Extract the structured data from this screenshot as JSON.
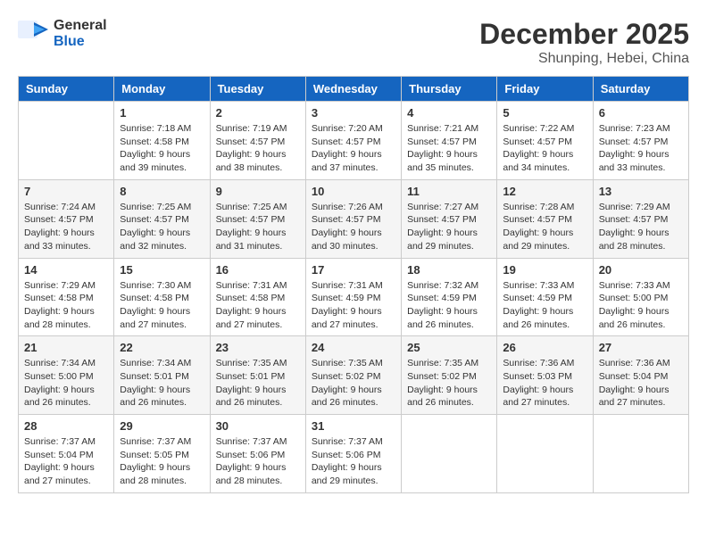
{
  "header": {
    "logo_line1": "General",
    "logo_line2": "Blue",
    "month_year": "December 2025",
    "location": "Shunping, Hebei, China"
  },
  "days_of_week": [
    "Sunday",
    "Monday",
    "Tuesday",
    "Wednesday",
    "Thursday",
    "Friday",
    "Saturday"
  ],
  "weeks": [
    [
      {
        "day": "",
        "info": ""
      },
      {
        "day": "1",
        "info": "Sunrise: 7:18 AM\nSunset: 4:58 PM\nDaylight: 9 hours\nand 39 minutes."
      },
      {
        "day": "2",
        "info": "Sunrise: 7:19 AM\nSunset: 4:57 PM\nDaylight: 9 hours\nand 38 minutes."
      },
      {
        "day": "3",
        "info": "Sunrise: 7:20 AM\nSunset: 4:57 PM\nDaylight: 9 hours\nand 37 minutes."
      },
      {
        "day": "4",
        "info": "Sunrise: 7:21 AM\nSunset: 4:57 PM\nDaylight: 9 hours\nand 35 minutes."
      },
      {
        "day": "5",
        "info": "Sunrise: 7:22 AM\nSunset: 4:57 PM\nDaylight: 9 hours\nand 34 minutes."
      },
      {
        "day": "6",
        "info": "Sunrise: 7:23 AM\nSunset: 4:57 PM\nDaylight: 9 hours\nand 33 minutes."
      }
    ],
    [
      {
        "day": "7",
        "info": "Sunrise: 7:24 AM\nSunset: 4:57 PM\nDaylight: 9 hours\nand 33 minutes."
      },
      {
        "day": "8",
        "info": "Sunrise: 7:25 AM\nSunset: 4:57 PM\nDaylight: 9 hours\nand 32 minutes."
      },
      {
        "day": "9",
        "info": "Sunrise: 7:25 AM\nSunset: 4:57 PM\nDaylight: 9 hours\nand 31 minutes."
      },
      {
        "day": "10",
        "info": "Sunrise: 7:26 AM\nSunset: 4:57 PM\nDaylight: 9 hours\nand 30 minutes."
      },
      {
        "day": "11",
        "info": "Sunrise: 7:27 AM\nSunset: 4:57 PM\nDaylight: 9 hours\nand 29 minutes."
      },
      {
        "day": "12",
        "info": "Sunrise: 7:28 AM\nSunset: 4:57 PM\nDaylight: 9 hours\nand 29 minutes."
      },
      {
        "day": "13",
        "info": "Sunrise: 7:29 AM\nSunset: 4:57 PM\nDaylight: 9 hours\nand 28 minutes."
      }
    ],
    [
      {
        "day": "14",
        "info": "Sunrise: 7:29 AM\nSunset: 4:58 PM\nDaylight: 9 hours\nand 28 minutes."
      },
      {
        "day": "15",
        "info": "Sunrise: 7:30 AM\nSunset: 4:58 PM\nDaylight: 9 hours\nand 27 minutes."
      },
      {
        "day": "16",
        "info": "Sunrise: 7:31 AM\nSunset: 4:58 PM\nDaylight: 9 hours\nand 27 minutes."
      },
      {
        "day": "17",
        "info": "Sunrise: 7:31 AM\nSunset: 4:59 PM\nDaylight: 9 hours\nand 27 minutes."
      },
      {
        "day": "18",
        "info": "Sunrise: 7:32 AM\nSunset: 4:59 PM\nDaylight: 9 hours\nand 26 minutes."
      },
      {
        "day": "19",
        "info": "Sunrise: 7:33 AM\nSunset: 4:59 PM\nDaylight: 9 hours\nand 26 minutes."
      },
      {
        "day": "20",
        "info": "Sunrise: 7:33 AM\nSunset: 5:00 PM\nDaylight: 9 hours\nand 26 minutes."
      }
    ],
    [
      {
        "day": "21",
        "info": "Sunrise: 7:34 AM\nSunset: 5:00 PM\nDaylight: 9 hours\nand 26 minutes."
      },
      {
        "day": "22",
        "info": "Sunrise: 7:34 AM\nSunset: 5:01 PM\nDaylight: 9 hours\nand 26 minutes."
      },
      {
        "day": "23",
        "info": "Sunrise: 7:35 AM\nSunset: 5:01 PM\nDaylight: 9 hours\nand 26 minutes."
      },
      {
        "day": "24",
        "info": "Sunrise: 7:35 AM\nSunset: 5:02 PM\nDaylight: 9 hours\nand 26 minutes."
      },
      {
        "day": "25",
        "info": "Sunrise: 7:35 AM\nSunset: 5:02 PM\nDaylight: 9 hours\nand 26 minutes."
      },
      {
        "day": "26",
        "info": "Sunrise: 7:36 AM\nSunset: 5:03 PM\nDaylight: 9 hours\nand 27 minutes."
      },
      {
        "day": "27",
        "info": "Sunrise: 7:36 AM\nSunset: 5:04 PM\nDaylight: 9 hours\nand 27 minutes."
      }
    ],
    [
      {
        "day": "28",
        "info": "Sunrise: 7:37 AM\nSunset: 5:04 PM\nDaylight: 9 hours\nand 27 minutes."
      },
      {
        "day": "29",
        "info": "Sunrise: 7:37 AM\nSunset: 5:05 PM\nDaylight: 9 hours\nand 28 minutes."
      },
      {
        "day": "30",
        "info": "Sunrise: 7:37 AM\nSunset: 5:06 PM\nDaylight: 9 hours\nand 28 minutes."
      },
      {
        "day": "31",
        "info": "Sunrise: 7:37 AM\nSunset: 5:06 PM\nDaylight: 9 hours\nand 29 minutes."
      },
      {
        "day": "",
        "info": ""
      },
      {
        "day": "",
        "info": ""
      },
      {
        "day": "",
        "info": ""
      }
    ]
  ]
}
